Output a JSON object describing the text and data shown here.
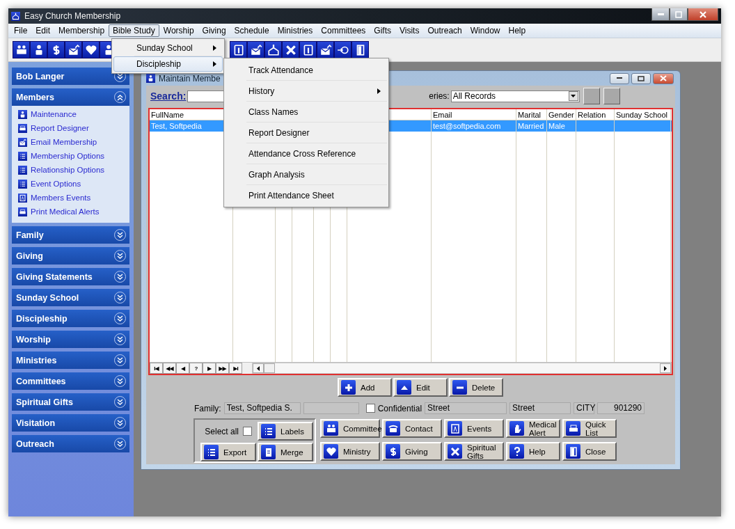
{
  "window": {
    "title": "Easy Church Membership"
  },
  "menu_bar": [
    {
      "label": "File",
      "selected": false
    },
    {
      "label": "Edit",
      "selected": false
    },
    {
      "label": "Membership",
      "selected": false
    },
    {
      "label": "Bible Study",
      "selected": true
    },
    {
      "label": "Worship",
      "selected": false
    },
    {
      "label": "Giving",
      "selected": false
    },
    {
      "label": "Schedule",
      "selected": false
    },
    {
      "label": "Ministries",
      "selected": false
    },
    {
      "label": "Committees",
      "selected": false
    },
    {
      "label": "Gifts",
      "selected": false
    },
    {
      "label": "Visits",
      "selected": false
    },
    {
      "label": "Outreach",
      "selected": false
    },
    {
      "label": "Window",
      "selected": false
    },
    {
      "label": "Help",
      "selected": false
    }
  ],
  "open_menu": [
    {
      "label": "Sunday School",
      "submenu": true,
      "selected": false
    },
    {
      "label": "Discipleship",
      "submenu": true,
      "selected": true
    }
  ],
  "submenu": [
    {
      "label": "Track Attendance",
      "submenu": false
    },
    {
      "label": "History",
      "submenu": true
    },
    {
      "label": "Class Names",
      "submenu": false
    },
    {
      "label": "Report Designer",
      "submenu": false
    },
    {
      "label": "Attendance Cross Reference",
      "submenu": false
    },
    {
      "label": "Graph Analysis",
      "submenu": false
    },
    {
      "label": "Print Attendance Sheet",
      "submenu": false
    }
  ],
  "sidebar": [
    {
      "title": "Bob Langer",
      "expanded": false
    },
    {
      "title": "Members",
      "expanded": true,
      "items": [
        "Maintenance",
        "Report Designer",
        "Email Membership",
        "Membership Options",
        "Relationship Options",
        "Event Options",
        "Members Events",
        "Print Medical Alerts"
      ]
    },
    {
      "title": "Family",
      "expanded": false
    },
    {
      "title": "Giving",
      "expanded": false
    },
    {
      "title": "Giving Statements",
      "expanded": false
    },
    {
      "title": "Sunday School",
      "expanded": false
    },
    {
      "title": "Discipleship",
      "expanded": false
    },
    {
      "title": "Worship",
      "expanded": false
    },
    {
      "title": "Ministries",
      "expanded": false
    },
    {
      "title": "Committees",
      "expanded": false
    },
    {
      "title": "Spiritual Gifts",
      "expanded": false
    },
    {
      "title": "Visitation",
      "expanded": false
    },
    {
      "title": "Outreach",
      "expanded": false
    }
  ],
  "child_window": {
    "title": "Maintain Membe",
    "search_label": "Search:",
    "query_label": "eries:",
    "query_value": "All Records"
  },
  "table": {
    "columns": [
      "FullName",
      "Email",
      "Marital",
      "Gender",
      "Relation",
      "Sunday School"
    ],
    "rows": [
      {
        "cells": [
          "Test, Softpedia",
          "test@softpedia.com",
          "Married",
          "Male"
        ],
        "selected": true
      }
    ]
  },
  "navigator": [
    "I◀",
    "◀◀",
    "◀",
    "?",
    "▶",
    "▶▶",
    "▶I"
  ],
  "actions": [
    "Add",
    "Edit",
    "Delete"
  ],
  "family": {
    "label": "Family:",
    "name": "Test, Softpedia S.",
    "confidential": {
      "label": "Confidential",
      "checked": false
    },
    "fields": [
      "Street",
      "Street",
      "CITY",
      "901290"
    ]
  },
  "tools": {
    "select_all": {
      "label": "Select all",
      "checked": false
    },
    "buttons": [
      "Labels",
      "Export",
      "Merge"
    ]
  },
  "buttons": [
    "Committee",
    "Contact",
    "Events",
    "Medical Alert",
    "Quick List",
    "Ministry",
    "Giving",
    "Spiritual Gifts",
    "Help",
    "Close"
  ]
}
